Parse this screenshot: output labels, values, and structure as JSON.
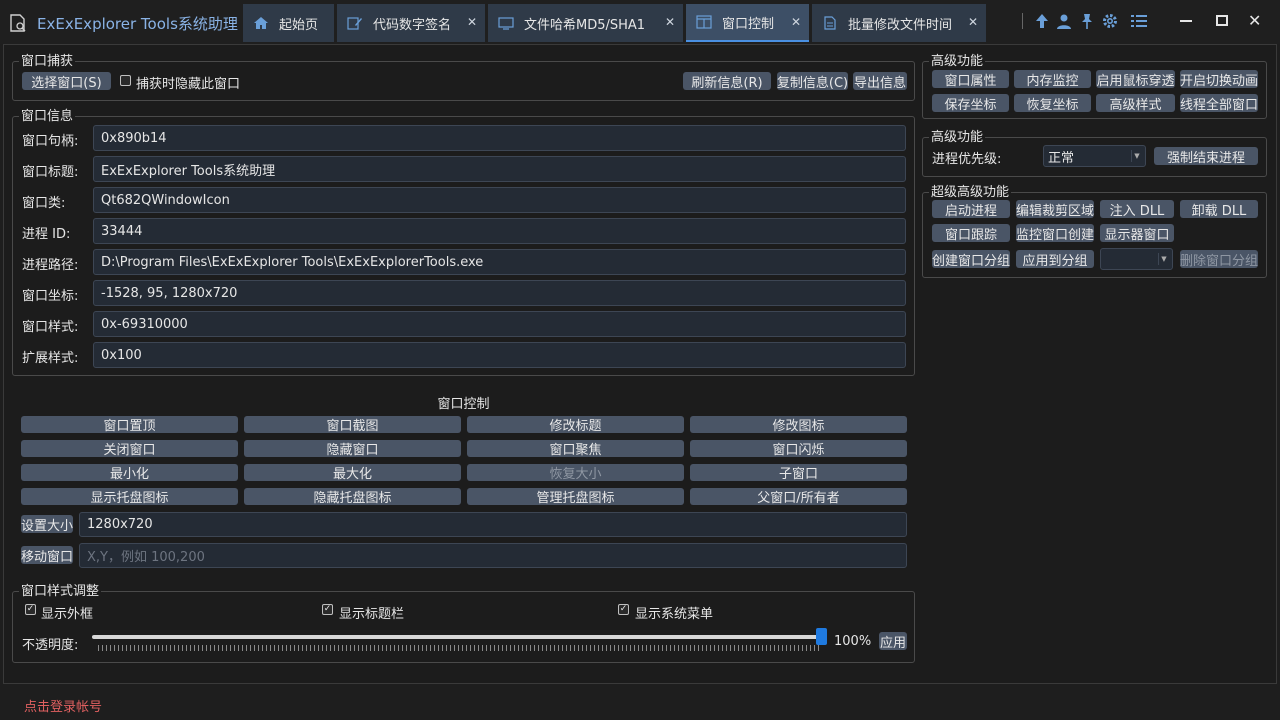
{
  "app": {
    "title": "ExExExplorer Tools系统助理"
  },
  "tabs": [
    {
      "label": "起始页",
      "icon": "home-icon",
      "closable": false,
      "active": false
    },
    {
      "label": "代码数字签名",
      "icon": "edit-icon",
      "closable": true,
      "active": false
    },
    {
      "label": "文件哈希MD5/SHA1",
      "icon": "monitor-icon",
      "closable": true,
      "active": false
    },
    {
      "label": "窗口控制",
      "icon": "window-icon",
      "closable": true,
      "active": true
    },
    {
      "label": "批量修改文件时间",
      "icon": "document-icon",
      "closable": true,
      "active": false
    }
  ],
  "toolbar_icons": [
    "arrow-up-icon",
    "user-icon",
    "pin-icon",
    "gear-icon",
    "list-icon"
  ],
  "window_buttons": {
    "close": "✕"
  },
  "capture": {
    "title": "窗口捕获",
    "select": "选择窗口(S)",
    "hide_label": "捕获时隐藏此窗口",
    "refresh": "刷新信息(R)",
    "copy": "复制信息(C)",
    "export": "导出信息"
  },
  "info": {
    "title": "窗口信息",
    "rows": [
      {
        "label": "窗口句柄:",
        "value": "0x890b14"
      },
      {
        "label": "窗口标题:",
        "value": "ExExExplorer Tools系统助理"
      },
      {
        "label": "窗口类:",
        "value": "Qt682QWindowIcon"
      },
      {
        "label": "进程 ID:",
        "value": "33444"
      },
      {
        "label": "进程路径:",
        "value": "D:\\Program Files\\ExExExplorer Tools\\ExExExplorerTools.exe"
      },
      {
        "label": "窗口坐标:",
        "value": "-1528, 95, 1280x720"
      },
      {
        "label": "窗口样式:",
        "value": "0x-69310000"
      },
      {
        "label": "扩展样式:",
        "value": "0x100"
      }
    ]
  },
  "control": {
    "title": "窗口控制",
    "buttons": [
      [
        "窗口置顶",
        "窗口截图",
        "修改标题",
        "修改图标"
      ],
      [
        "关闭窗口",
        "隐藏窗口",
        "窗口聚焦",
        "窗口闪烁"
      ],
      [
        "最小化",
        "最大化",
        "恢复大小",
        "子窗口"
      ],
      [
        "显示托盘图标",
        "隐藏托盘图标",
        "管理托盘图标",
        "父窗口/所有者"
      ]
    ],
    "set_size": "设置大小",
    "size_value": "1280x720",
    "move": "移动窗口",
    "move_placeholder": "X,Y，例如 100,200"
  },
  "style": {
    "title": "窗口样式调整",
    "show_frame": "显示外框",
    "show_titlebar": "显示标题栏",
    "show_sysmenu": "显示系统菜单",
    "opacity_label": "不透明度:",
    "opacity_value": "100%",
    "opacity_level": 1.0,
    "apply": "应用"
  },
  "advanced1": {
    "title": "高级功能",
    "buttons": [
      "窗口属性",
      "内存监控",
      "启用鼠标穿透",
      "开启切换动画",
      "保存坐标",
      "恢复坐标",
      "高级样式",
      "线程全部窗口"
    ]
  },
  "advanced2": {
    "title": "高级功能",
    "priority_label": "进程优先级:",
    "priority_value": "正常",
    "kill": "强制结束进程"
  },
  "super": {
    "title": "超级高级功能",
    "row1": [
      "启动进程",
      "编辑裁剪区域",
      "注入 DLL",
      "卸载 DLL"
    ],
    "row2": [
      "窗口跟踪",
      "监控窗口创建",
      "显示器窗口"
    ],
    "create_group": "创建窗口分组",
    "apply_group": "应用到分组",
    "delete_group": "删除窗口分组"
  },
  "status": {
    "login": "点击登录帐号"
  },
  "colors": {
    "accent": "#4a90e2",
    "button": "#4a5566",
    "login": "#e06060"
  }
}
